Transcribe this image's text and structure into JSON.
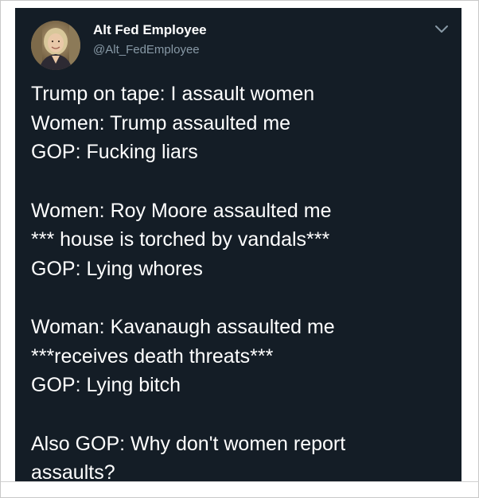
{
  "tweet": {
    "author_name": "Alt Fed Employee",
    "author_handle": "@Alt_FedEmployee",
    "paragraphs": [
      {
        "lines": [
          "Trump on tape: I assault women",
          "Women: Trump assaulted me",
          "GOP: Fucking liars"
        ]
      },
      {
        "lines": [
          "Women: Roy Moore assaulted me",
          "*** house is torched by vandals***",
          "GOP: Lying whores"
        ]
      },
      {
        "lines": [
          "Woman: Kavanaugh assaulted me",
          "***receives death threats***",
          "GOP: Lying bitch"
        ]
      },
      {
        "lines": [
          "Also GOP: Why don't women report",
          "assaults?"
        ]
      }
    ]
  },
  "icons": {
    "avatar": "avatar-portrait",
    "menu": "chevron-down-icon"
  },
  "colors": {
    "card_background": "#141d26",
    "text_primary": "#ffffff",
    "text_secondary": "#8899a6",
    "page_background": "#ffffff"
  }
}
